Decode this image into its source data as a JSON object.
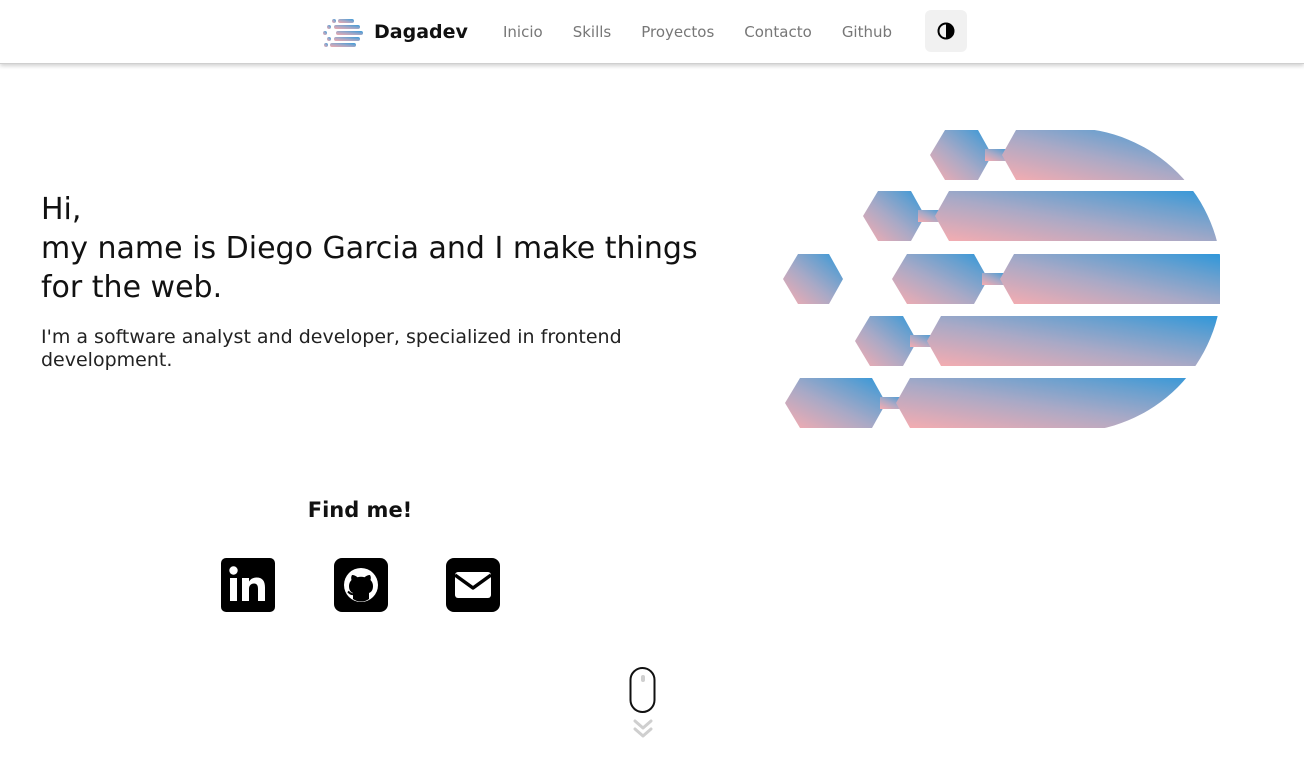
{
  "colors": {
    "gradient_start": "#f2a9ad",
    "gradient_mid": "#9fa8c8",
    "gradient_end": "#3a9ad8",
    "nav_text": "#777777",
    "icon_fill": "#000000"
  },
  "navbar": {
    "brand": "Dagadev",
    "links": [
      "Inicio",
      "Skills",
      "Proyectos",
      "Contacto",
      "Github"
    ],
    "theme_toggle_icon": "contrast-half-circle-icon"
  },
  "hero": {
    "greeting": "Hi,",
    "line2": "my name is Diego Garcia and I make things",
    "line3": "for the web.",
    "subtitle": "I'm a software analyst and developer, specialized in frontend development."
  },
  "find": {
    "title": "Find me!",
    "icons": [
      "linkedin-icon",
      "github-icon",
      "email-icon"
    ]
  },
  "scroll_hint": {
    "icons": [
      "mouse-icon",
      "double-chevron-down-icon"
    ]
  }
}
